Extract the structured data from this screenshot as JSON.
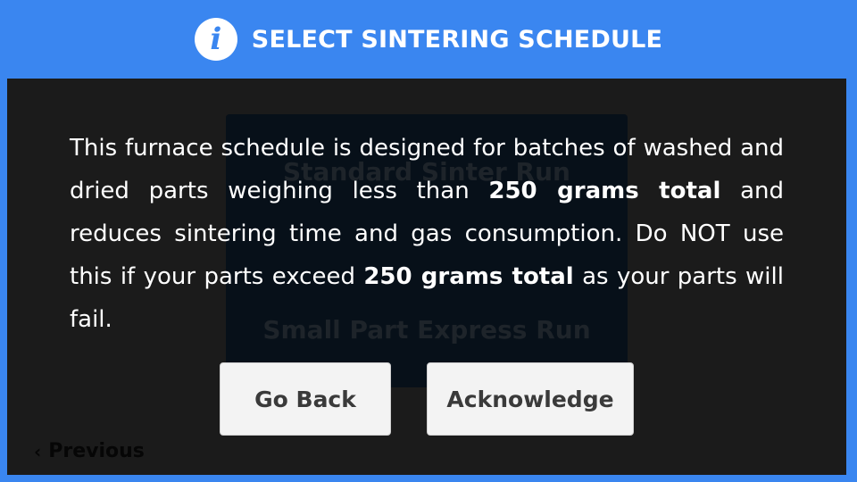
{
  "header": {
    "icon": "info-icon",
    "icon_glyph": "i",
    "title": "SELECT SINTERING SCHEDULE"
  },
  "background": {
    "options": [
      "Standard Sinter Run",
      "Small Part Express Run"
    ],
    "previous_label": "Previous"
  },
  "dialog": {
    "message": {
      "p1": "This furnace schedule is designed for batches of washed and dried parts weighing less than ",
      "b1": "250 grams total",
      "p2": " and reduces sintering time and gas consumption. Do NOT use this if your parts exceed ",
      "b2": "250 grams total",
      "p3": " as your parts will fail."
    },
    "buttons": {
      "go_back": "Go Back",
      "acknowledge": "Acknowledge"
    }
  },
  "colors": {
    "accent": "#3a86f0",
    "screen_bg": "#1b1b1b",
    "button_bg": "#f3f3f3"
  }
}
